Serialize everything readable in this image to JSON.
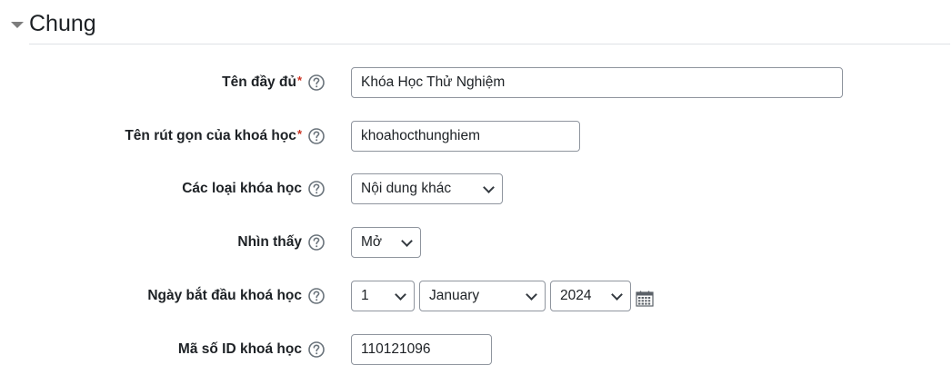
{
  "section": {
    "title": "Chung"
  },
  "fields": {
    "fullname": {
      "label": "Tên đầy đủ",
      "required_mark": "*",
      "value": "Khóa Học Thử Nghiệm"
    },
    "shortname": {
      "label": "Tên rút gọn của khoá học",
      "required_mark": "*",
      "value": "khoahocthunghiem"
    },
    "category": {
      "label": "Các loại khóa học",
      "selected": "Nội dung khác"
    },
    "visibility": {
      "label": "Nhìn thấy",
      "selected": "Mở"
    },
    "startdate": {
      "label": "Ngày bắt đầu khoá học",
      "day": "1",
      "month": "January",
      "year": "2024"
    },
    "idnumber": {
      "label": "Mã số ID khoá học",
      "value": "110121096"
    }
  },
  "icons": {
    "help": "question-circle-icon",
    "calendar": "calendar-icon",
    "collapse": "caret-down-icon"
  },
  "colors": {
    "required": "#ca3120",
    "border": "#8f959e",
    "text": "#1d2125"
  }
}
